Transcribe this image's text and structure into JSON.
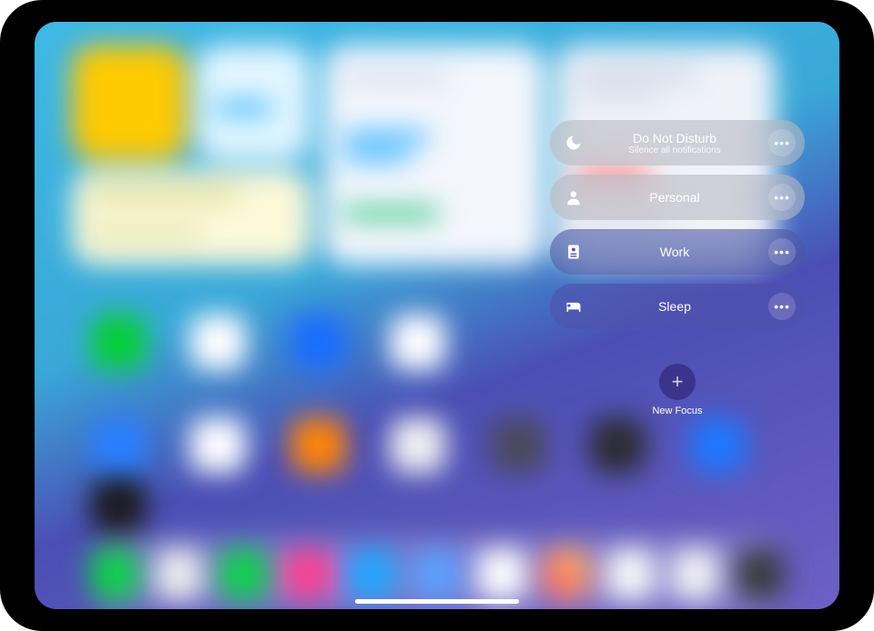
{
  "focus_menu": {
    "items": [
      {
        "id": "dnd",
        "title": "Do Not Disturb",
        "subtitle": "Silence all notifications",
        "icon": "moon"
      },
      {
        "id": "personal",
        "title": "Personal",
        "subtitle": "",
        "icon": "person"
      },
      {
        "id": "work",
        "title": "Work",
        "subtitle": "",
        "icon": "badge"
      },
      {
        "id": "sleep",
        "title": "Sleep",
        "subtitle": "",
        "icon": "bed"
      }
    ],
    "new_focus_label": "New Focus"
  }
}
